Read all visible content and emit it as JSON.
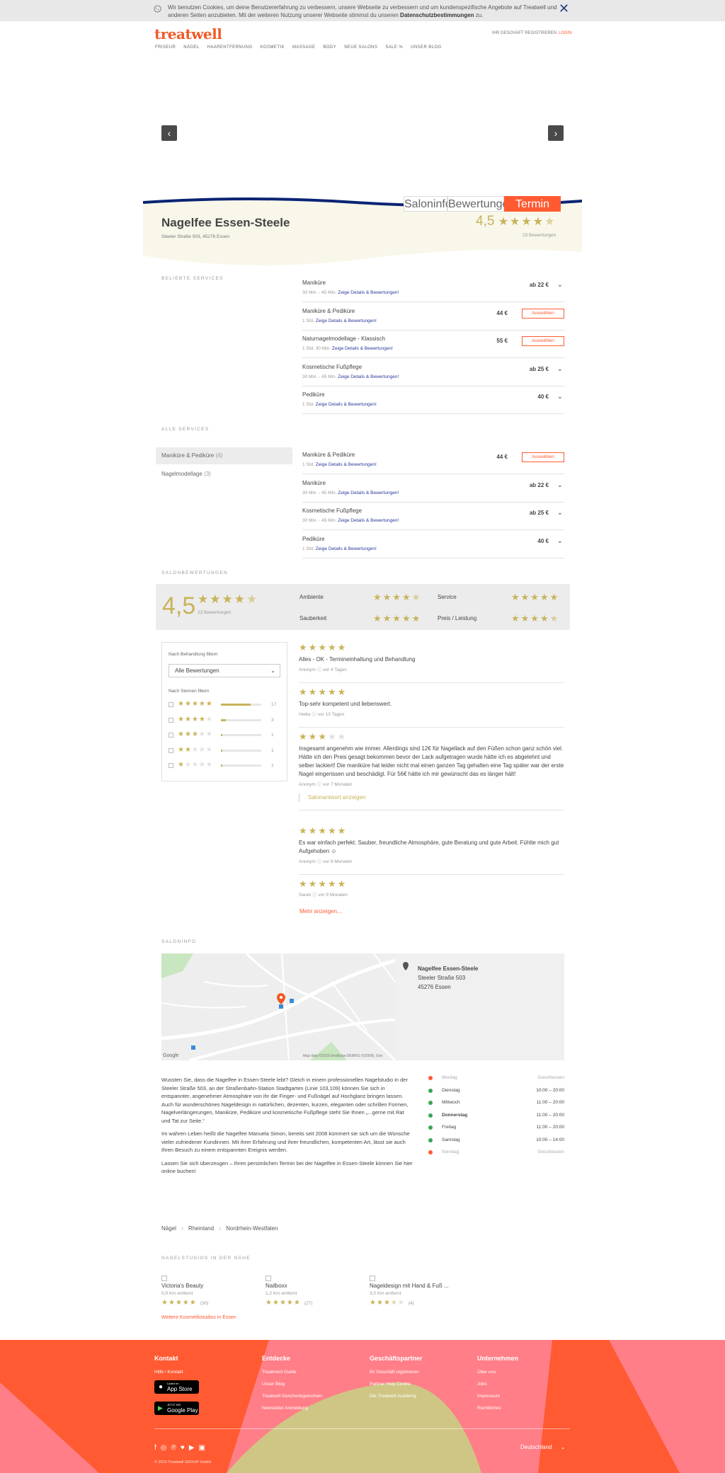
{
  "cookie": {
    "text_1": "Wir benutzen Cookies, um deine Benutzererfahrung zu verbessern, unsere Webseite zu verbessern und um kundenspezifische Angebote auf Treatwell und anderen Seiten anzubieten. Mit der weiteren Nutzung unserer Webseite stimmst du unseren",
    "link": "Datenschutzbestimmungen",
    "text_2": "zu."
  },
  "header": {
    "logo": "treatwell",
    "register": "IHR GESCHÄFT REGISTRIEREN",
    "login": "LOGIN",
    "nav": [
      "FRISEUR",
      "NÄGEL",
      "HAARENTFERNUNG",
      "KOSMETIK",
      "MASSAGE",
      "BODY",
      "NEUE SALONS",
      "SALE %",
      "UNSER BLOG"
    ]
  },
  "tabs": {
    "info": "Saloninfo",
    "reviews": "Bewertungen",
    "book": "Termin buchen"
  },
  "salon": {
    "name": "Nagelfee Essen-Steele",
    "address": "Steeler Straße 503, 45276 Essen",
    "rating": "4,5",
    "review_count": "23 Bewertungen"
  },
  "popular": {
    "title": "BELIEBTE SERVICES",
    "items": [
      {
        "name": "Maniküre",
        "duration": "30 Min. - 45 Min.",
        "link": "Zeige Details & Bewertungen!",
        "price": "ab 22 €",
        "action": "chevron"
      },
      {
        "name": "Maniküre & Pediküre",
        "duration": "1 Std.",
        "link": "Zeige Details & Bewertungen!",
        "price": "44 €",
        "action": "Auswählen"
      },
      {
        "name": "Naturnagelmodellage - Klassisch",
        "duration": "1 Std. 30 Min.",
        "link": "Zeige Details & Bewertungen!",
        "price": "55 €",
        "action": "Auswählen"
      },
      {
        "name": "Kosmetische Fußpflege",
        "duration": "30 Min. - 45 Min.",
        "link": "Zeige Details & Bewertungen!",
        "price": "ab 25 €",
        "action": "chevron"
      },
      {
        "name": "Pediküre",
        "duration": "1 Std.",
        "link": "Zeige Details & Bewertungen!",
        "price": "40 €",
        "action": "chevron"
      }
    ]
  },
  "all_services": {
    "title": "ALLE SERVICES",
    "categories": [
      {
        "name": "Maniküre & Pediküre",
        "count": "(4)"
      },
      {
        "name": "Nagelmodellage",
        "count": "(3)"
      }
    ],
    "items": [
      {
        "name": "Maniküre & Pediküre",
        "duration": "1 Std.",
        "link": "Zeige Details & Bewertungen!",
        "price": "44 €",
        "action": "Auswählen"
      },
      {
        "name": "Maniküre",
        "duration": "30 Min. - 45 Min.",
        "link": "Zeige Details & Bewertungen!",
        "price": "ab 22 €",
        "action": "chevron"
      },
      {
        "name": "Kosmetische Fußpflege",
        "duration": "30 Min. - 45 Min.",
        "link": "Zeige Details & Bewertungen!",
        "price": "ab 25 €",
        "action": "chevron"
      },
      {
        "name": "Pediküre",
        "duration": "1 Std.",
        "link": "Zeige Details & Bewertungen!",
        "price": "40 €",
        "action": "chevron"
      }
    ]
  },
  "reviews": {
    "title": "SALONBEWERTUNGEN",
    "overall": "4,5",
    "overall_stars": 4.5,
    "count": "23 Bewertungen",
    "aspects": [
      {
        "label": "Ambiente",
        "stars": 4.5
      },
      {
        "label": "Service",
        "stars": 5
      },
      {
        "label": "Sauberkeit",
        "stars": 5
      },
      {
        "label": "Preis / Leistung",
        "stars": 4.5
      }
    ],
    "filter_treatment_label": "Nach Behandlung filtern",
    "filter_select": "Alle Bewertungen",
    "filter_stars_label": "Nach Sternen filtern",
    "distribution": [
      {
        "stars": 5,
        "count": "17",
        "fraction": 0.74
      },
      {
        "stars": 4,
        "count": "3",
        "fraction": 0.13
      },
      {
        "stars": 3,
        "count": "1",
        "fraction": 0.04
      },
      {
        "stars": 2,
        "count": "1",
        "fraction": 0.04
      },
      {
        "stars": 1,
        "count": "1",
        "fraction": 0.04
      }
    ],
    "items": [
      {
        "stars": 5,
        "text": "Alles - OK - Termineinhaltung und Behandlung",
        "author": "Anonym",
        "when": "vor 4 Tagen"
      },
      {
        "stars": 5,
        "text": "Top-sehr kompetent und liebenswert.",
        "author": "Heike",
        "when": "vor 10 Tagen"
      },
      {
        "stars": 3,
        "text": "Insgesamt angenehm wie immer. Allerdings sind 12€ für Nagellack auf den Füßen schon ganz schön viel. Hätte ich den Preis gesagt bekommen bevor der Lack aufgetragen wurde hätte ich es abgelehnt und selber lackiert! Die maniküre hat leider nicht mal einen ganzen Tag gehalten eine Tag später war der erste Nagel eingerissen und beschädigt. Für 56€ hätte ich mir gewünscht das es länger hält!",
        "author": "Anonym",
        "when": "vor 7 Monaten",
        "reply": "Salonantwort anzeigen"
      },
      {
        "stars": 5,
        "text": "Es war einfach perfekt. Sauber, freundliche Atmosphäre, gute Beratung und gute Arbeit. Fühlte mich gut Aufgehoben ☺",
        "author": "Anonym",
        "when": "vor 8 Monaten"
      },
      {
        "stars": 5,
        "text": "",
        "author": "Sarah",
        "when": "vor 9 Monaten"
      }
    ],
    "more": "Mehr anzeigen..."
  },
  "saloninfo": {
    "title": "SALONINFO",
    "map_name": "Nagelfee Essen-Steele",
    "map_street": "Steeler Straße 503",
    "map_city": "45276 Essen",
    "map_credit": "Map data ©2019 GeoBasis-DE/BKG (©2009), Goo",
    "map_logo": "Google",
    "desc": [
      "Wussten Sie, dass die Nagelfee in Essen-Steele lebt? Gleich in einem professionellen Nagelstudio in der Steeler Straße 503, an der Straßenbahn-Station Stadtgarten (Linie 103,109) können Sie sich in entspannter, angenehmer Atmosphäre von ihr die Finger- und Fußnägel auf Hochglanz bringen lassen. Auch für wunderschönes Nageldesign in natürlichen, dezenten, kurzen, eleganten oder schrillen Formen, Nagelverlängerungen, Maniküre, Pediküre und kosmetische Fußpflege steht Sie Ihnen „...gerne mit Rat und Tat zur Seite.“",
      "Im wahren Leben heißt die Nagelfee Manuela Simon, bereits seit 2008 kümmert sie sich um die Wünsche vieler zufriedener Kundinnen. Mit ihrer Erfahrung und ihrer freundlichen, kompetenten Art, lässt sie auch Ihren Besuch zu einem entspannten Ereignis werden.",
      "Lassen Sie sich überzeugen – Ihren persönlichen Termin bei der Nagelfee in Essen-Steele können Sie hier online buchen!"
    ],
    "hours": [
      {
        "day": "Montag",
        "time": "Geschlossen",
        "open": false
      },
      {
        "day": "Dienstag",
        "time": "10:00 – 20:00",
        "open": true
      },
      {
        "day": "Mittwoch",
        "time": "11:00 – 20:00",
        "open": true
      },
      {
        "day": "Donnerstag",
        "time": "11:00 – 20:00",
        "open": true
      },
      {
        "day": "Freitag",
        "time": "11:00 – 20:00",
        "open": true
      },
      {
        "day": "Samstag",
        "time": "10:00 – 14:00",
        "open": true
      },
      {
        "day": "Sonntag",
        "time": "Geschlossen",
        "open": false
      }
    ]
  },
  "breadcrumb": [
    "Nägel",
    "Rheinland",
    "Nordrhein-Westfalen"
  ],
  "nearby": {
    "title": "NAGELSTUDIOS IN DER NÄHE",
    "items": [
      {
        "name": "Victoria's Beauty",
        "distance": "0,9 Km entfernt",
        "stars": 5,
        "count": "(30)"
      },
      {
        "name": "Nailboxx",
        "distance": "1,2 Km entfernt",
        "stars": 5,
        "count": "(27)"
      },
      {
        "name": "Nageldesign mit Hand & Fuß ...",
        "distance": "3,0 Km entfernt",
        "stars": 3.5,
        "count": "(4)"
      }
    ],
    "more": "Weitere Kosmetikstudios in Essen"
  },
  "footer": {
    "cols": [
      {
        "title": "Kontakt",
        "links": [
          "Hilfe / Kontakt"
        ]
      },
      {
        "title": "Entdecke",
        "links": [
          "Treatment Guide",
          "Unser Blog",
          "Treatwell Geschenkgutschein",
          "Newsletter Anmeldung"
        ]
      },
      {
        "title": "Geschäftspartner",
        "links": [
          "Ihr Geschäft registrieren",
          "Partner Help Centre",
          "Die Treatwell Academy"
        ]
      },
      {
        "title": "Unternehmen",
        "links": [
          "Über uns",
          "Jobs",
          "Impressum",
          "Rechtliches"
        ]
      }
    ],
    "appstore": "App Store",
    "appstore_small": "Laden im",
    "googleplay": "Google Play",
    "googleplay_small": "JETZT BEI",
    "language": "Deutschland",
    "copyright": "© 2019 Treatwell GROUP GmbH",
    "colors": {
      "orange": "#ff5a32",
      "pink": "#ff7e88",
      "olive": "#cfc685"
    }
  }
}
